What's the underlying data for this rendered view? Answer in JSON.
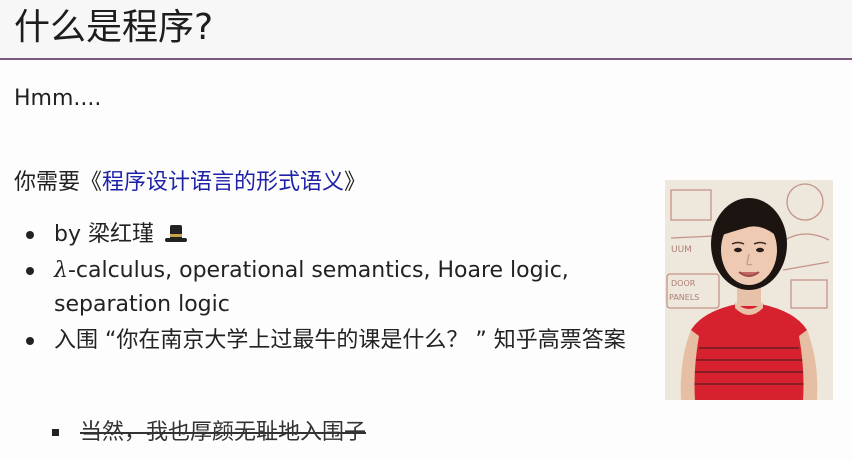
{
  "slide": {
    "title": "什么是程序?",
    "line1": "Hmm....",
    "line2_prefix": "你需要《",
    "line2_link": "程序设计语言的形式语义",
    "line2_suffix": "》",
    "bullets": [
      {
        "text": "by 梁红瑾",
        "icon": "top-hat-icon"
      },
      {
        "prefix": "λ",
        "text": "-calculus, operational semantics, Hoare logic, separation logic"
      },
      {
        "text": "入围 “你在南京大学上过最牛的课是什么？ ” 知乎高票答案"
      }
    ],
    "sub_bullet": "当然，我也厚颜无耻地入围子",
    "photo": "portrait-photo",
    "colors": {
      "accent": "#7e5a80",
      "link": "#1e22a8",
      "shirt": "#d6212c"
    }
  }
}
